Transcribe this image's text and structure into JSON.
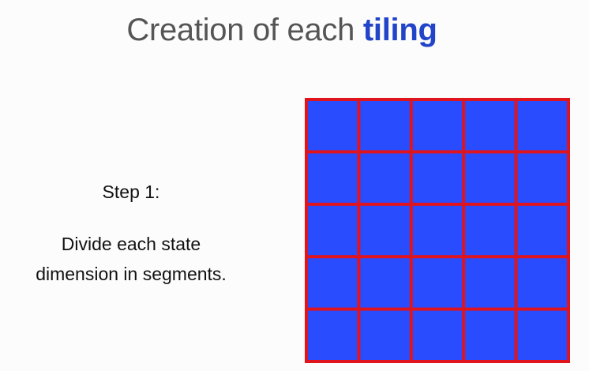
{
  "title": {
    "prefix": "Creation of each ",
    "highlight": "tiling"
  },
  "step": {
    "label": "Step 1:",
    "description_line1": "Divide each state",
    "description_line2": "dimension in segments."
  },
  "grid": {
    "rows": 5,
    "columns": 5,
    "cell_color": "#2a4cff",
    "line_color": "#e0141c"
  },
  "colors": {
    "title_text": "#555555",
    "title_highlight": "#2244c8",
    "body_text": "#111111",
    "background": "#fcfcfc"
  }
}
